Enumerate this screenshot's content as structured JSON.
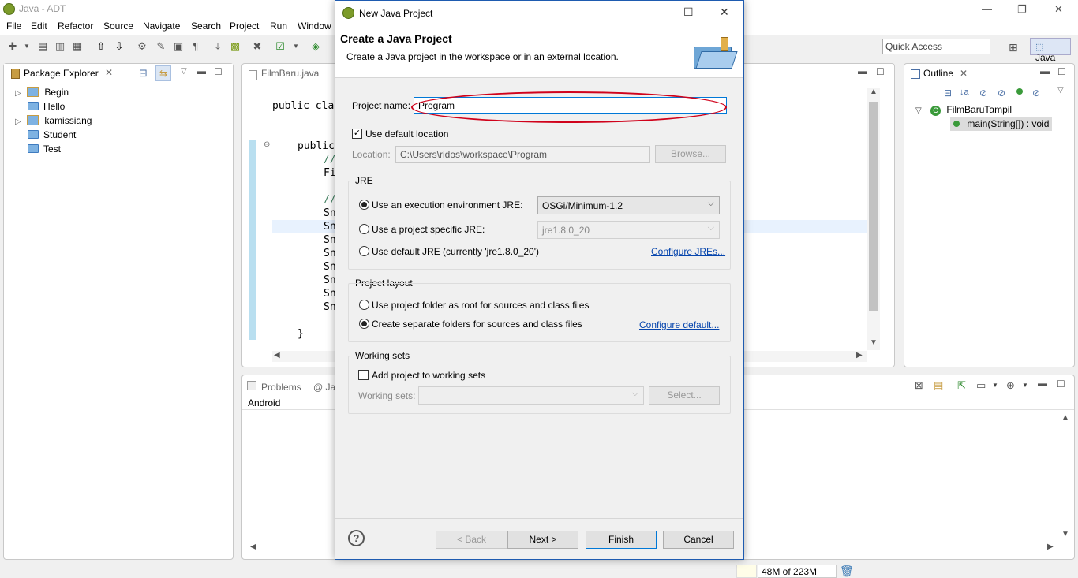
{
  "window": {
    "title": "Java - ADT",
    "menu": [
      "File",
      "Edit",
      "Refactor",
      "Source",
      "Navigate",
      "Search",
      "Project",
      "Run",
      "Window"
    ]
  },
  "toolbar": {
    "quick_access_placeholder": "Quick Access",
    "perspective": "Java"
  },
  "package_explorer": {
    "tab": "Package Explorer",
    "items": [
      {
        "label": "Begin",
        "expandable": true,
        "icon": "project-icon"
      },
      {
        "label": "Hello",
        "expandable": false,
        "icon": "folder-icon"
      },
      {
        "label": "kamissiang",
        "expandable": true,
        "icon": "project-icon"
      },
      {
        "label": "Student",
        "expandable": false,
        "icon": "folder-icon"
      },
      {
        "label": "Test",
        "expandable": false,
        "icon": "folder-icon"
      }
    ]
  },
  "editor": {
    "tab": "FilmBaru.java",
    "lines": [
      {
        "text": "public cla"
      },
      {
        "text": "public"
      },
      {
        "text": "//"
      },
      {
        "text": "Fi"
      },
      {
        "text": "//"
      },
      {
        "text": "Sn"
      },
      {
        "text": "Sn"
      },
      {
        "text": "Sn"
      },
      {
        "text": "Sn"
      },
      {
        "text": "Sn"
      },
      {
        "text": "Sn"
      },
      {
        "text": "Sn"
      },
      {
        "text": "Sn"
      },
      {
        "text": "}"
      }
    ]
  },
  "outline": {
    "tab": "Outline",
    "class_name": "FilmBaruTampil",
    "method": "main(String[]) : void"
  },
  "bottom_panel": {
    "tab": "Problems",
    "tab2_partial": "@ Ja",
    "content": "Android"
  },
  "status": {
    "heap": "48M of 223M"
  },
  "dialog": {
    "title": "New Java Project",
    "heading": "Create a Java Project",
    "description": "Create a Java project in the workspace or in an external location.",
    "project_name_label": "Project name:",
    "project_name_value": "Program",
    "use_default_location_label": "Use default location",
    "use_default_location_checked": true,
    "location_label": "Location:",
    "location_value": "C:\\Users\\ridos\\workspace\\Program",
    "browse_label": "Browse...",
    "jre": {
      "group_label": "JRE",
      "opt_env_label": "Use an execution environment JRE:",
      "opt_env_value": "OSGi/Minimum-1.2",
      "opt_specific_label": "Use a project specific JRE:",
      "opt_specific_value": "jre1.8.0_20",
      "opt_default_label": "Use default JRE (currently 'jre1.8.0_20')",
      "configure_link": "Configure JREs..."
    },
    "layout": {
      "group_label": "Project layout",
      "opt_root_label": "Use project folder as root for sources and class files",
      "opt_separate_label": "Create separate folders for sources and class files",
      "configure_link": "Configure default..."
    },
    "working_sets": {
      "group_label": "Working sets",
      "add_label": "Add project to working sets",
      "sets_label": "Working sets:",
      "select_label": "Select..."
    },
    "buttons": {
      "back": "< Back",
      "next": "Next >",
      "finish": "Finish",
      "cancel": "Cancel"
    },
    "help_glyph": "?"
  },
  "colors": {
    "accent": "#0078d7",
    "annotation": "#d0021b",
    "link": "#0645ad"
  }
}
